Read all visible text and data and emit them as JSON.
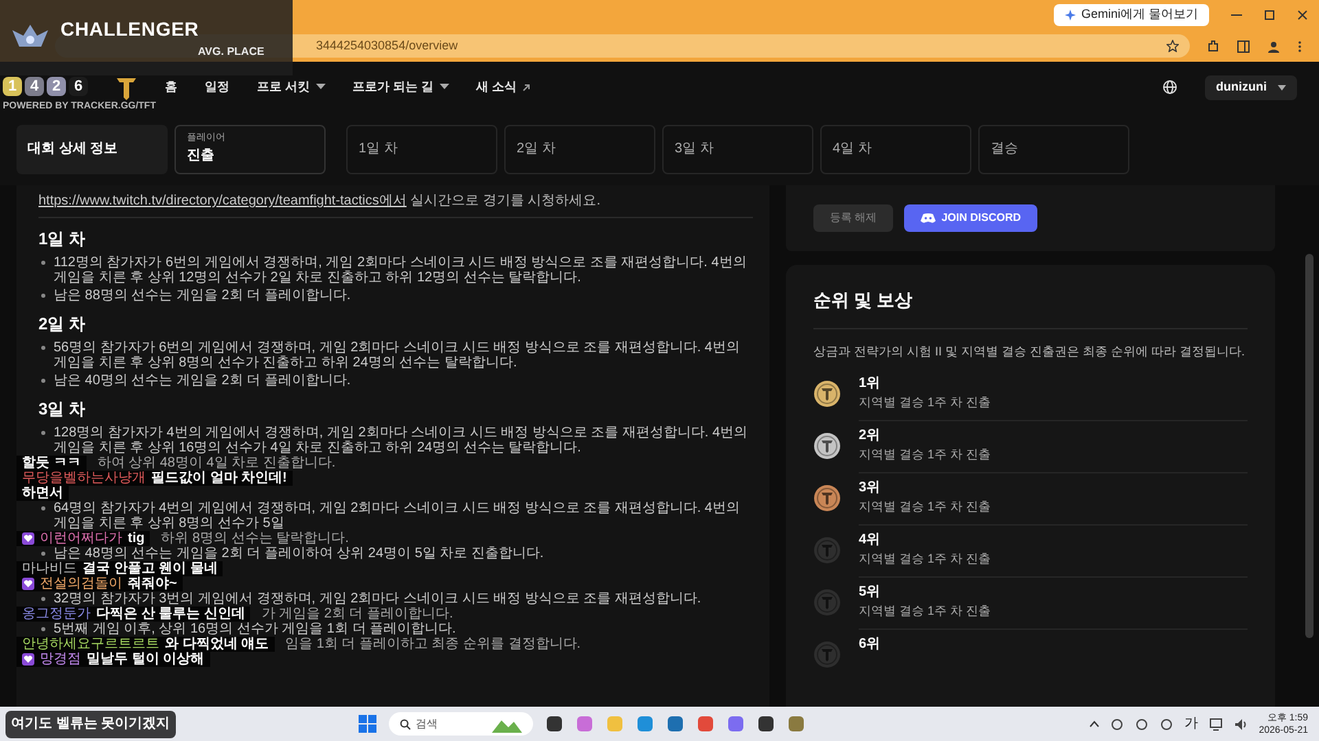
{
  "browser": {
    "url": "3444254030854/overview",
    "gemini_button": "Gemini에게 물어보기"
  },
  "stream_overlay": {
    "rank": "CHALLENGER",
    "stat_label": "AVG. PLACE",
    "placements": [
      {
        "value": "1",
        "color": "#d8c25a"
      },
      {
        "value": "4",
        "color": "#7d7d8c"
      },
      {
        "value": "2",
        "color": "#9090aa"
      },
      {
        "value": "6",
        "color": "#1c1c1c"
      }
    ],
    "credit": "POWERED BY TRACKER.GG/TFT"
  },
  "nav": {
    "items": [
      {
        "label": "홈",
        "kind": "plain"
      },
      {
        "label": "일정",
        "kind": "plain"
      },
      {
        "label": "프로 서킷",
        "kind": "dropdown"
      },
      {
        "label": "프로가 되는 길",
        "kind": "dropdown"
      },
      {
        "label": "새 소식",
        "kind": "external"
      }
    ],
    "user": "dunizuni"
  },
  "tabs": [
    {
      "kind": "tab",
      "label": "대회 상세 정보",
      "selected": true
    },
    {
      "kind": "picker",
      "caption": "플레이어",
      "label": "진출",
      "selected": false
    },
    {
      "kind": "tab",
      "label": "1일 차",
      "selected": false
    },
    {
      "kind": "tab",
      "label": "2일 차",
      "selected": false
    },
    {
      "kind": "tab",
      "label": "3일 차",
      "selected": false
    },
    {
      "kind": "tab",
      "label": "4일 차",
      "selected": false
    },
    {
      "kind": "tab",
      "label": "결승",
      "selected": false
    }
  ],
  "details": {
    "link": "https://www.twitch.tv/directory/category/teamfight-tactics에서",
    "link_suffix": "실시간으로 경기를 시청하세요.",
    "sections": [
      {
        "heading": "1일 차",
        "bullets": [
          "112명의 참가자가 6번의 게임에서 경쟁하며, 게임 2회마다 스네이크 시드 배정 방식으로 조를 재편성합니다. 4번의 게임을 치른 후 상위 12명의 선수가 2일 차로 진출하고 하위 12명의 선수는 탈락합니다.",
          "남은 88명의 선수는 게임을 2회 더 플레이합니다."
        ]
      },
      {
        "heading": "2일 차",
        "bullets": [
          "56명의 참가자가 6번의 게임에서 경쟁하며, 게임 2회마다 스네이크 시드 배정 방식으로 조를 재편성합니다. 4번의 게임을 치른 후 상위 8명의 선수가 진출하고 하위 24명의 선수는 탈락합니다.",
          "남은 40명의 선수는 게임을 2회 더 플레이합니다."
        ]
      },
      {
        "heading": "3일 차",
        "bullets": [
          "128명의 참가자가 4번의 게임에서 경쟁하며, 게임 2회마다 스네이크 시드 배정 방식으로 조를 재편성합니다. 4번의 게임을 치른 후 상위 16명의 선수가 4일 차로 진출하고 하위 24명의 선수는 탈락합니다.",
          "하여 상위 48명이 4일 차로 진출합니다."
        ]
      },
      {
        "bullets": [
          "64명의 참가자가 4번의 게임에서 경쟁하며, 게임 2회마다 스네이크 시드 배정 방식으로 조를 재편성합니다. 4번의 게임을 치른 후 상위 8명의 선수가 5일",
          "하위 8명의 선수는 탈락합니다.",
          "남은 48명의 선수는 게임을 2회 더 플레이하여 상위 24명이 5일 차로 진출합니다."
        ]
      },
      {
        "bullets": [
          "32명의 참가자가 3번의 게임에서 경쟁하며, 게임 2회마다 스네이크 시드 배정 방식으로 조를 재편성합니다.",
          "가 게임을 2회 더 플레이합니다.",
          "5번째 게임 이후, 상위 16명의 선수가 게임을 1회 더 플레이합니다.",
          "임을 1회 더 플레이하고 최종 순위를 결정합니다."
        ]
      }
    ]
  },
  "chat": [
    {
      "badge": false,
      "text": "할듯 ㅋㅋ"
    },
    {
      "badge": false,
      "user": "무당을벨하는사냥개",
      "color": "#e05a5a",
      "text": "필드값이 얼마 차인데!"
    },
    {
      "badge": false,
      "text": "하면서"
    },
    {
      "badge": true,
      "user": "이런어쩌다가",
      "color": "#e070b0",
      "text": "tig"
    },
    {
      "badge": false,
      "user": "마나비드",
      "color": "#c8c8c8",
      "text": "결국 안풀고 웬이 물네"
    },
    {
      "badge": true,
      "user": "전설의검돌이",
      "color": "#f0a868",
      "text": "줘줘야~"
    },
    {
      "badge": false,
      "user": "옹그정둔가",
      "color": "#8a8ae6",
      "text": "다찍은 산 룰루는 신인데"
    },
    {
      "badge": false,
      "user": "안녕하세요구르트르트",
      "color": "#a6d860",
      "text": "와 다찍었네 얘도"
    },
    {
      "badge": true,
      "user": "망경점",
      "color": "#c48af0",
      "text": "밀날두 털이 이상해"
    },
    {
      "badge": false,
      "text": "여기도 벨류는 못이기겠지"
    }
  ],
  "registration": {
    "buttons": [
      {
        "label": "등록 해제",
        "kind": "secondary"
      },
      {
        "label": "JOIN DISCORD",
        "kind": "discord"
      }
    ]
  },
  "rewards": {
    "title": "순위 및 보상",
    "description": "상금과 전략가의 시험 II 및 지역별 결승 진출권은 최종 순위에 따라 결정됩니다.",
    "ranks": [
      {
        "place": "1위",
        "reward": "지역별 결승 1주 차 진출",
        "color": "#d9b46a"
      },
      {
        "place": "2위",
        "reward": "지역별 결승 1주 차 진출",
        "color": "#c4c4c4"
      },
      {
        "place": "3위",
        "reward": "지역별 결승 1주 차 진출",
        "color": "#c98656"
      },
      {
        "place": "4위",
        "reward": "지역별 결승 1주 차 진출",
        "color": "#2e2e2e"
      },
      {
        "place": "5위",
        "reward": "지역별 결승 1주 차 진출",
        "color": "#2e2e2e"
      },
      {
        "place": "6위",
        "color": "#2e2e2e"
      }
    ]
  },
  "taskbar": {
    "search": "검색",
    "ime": "가",
    "time": "오후 1:59",
    "date": "2026-05-21"
  }
}
